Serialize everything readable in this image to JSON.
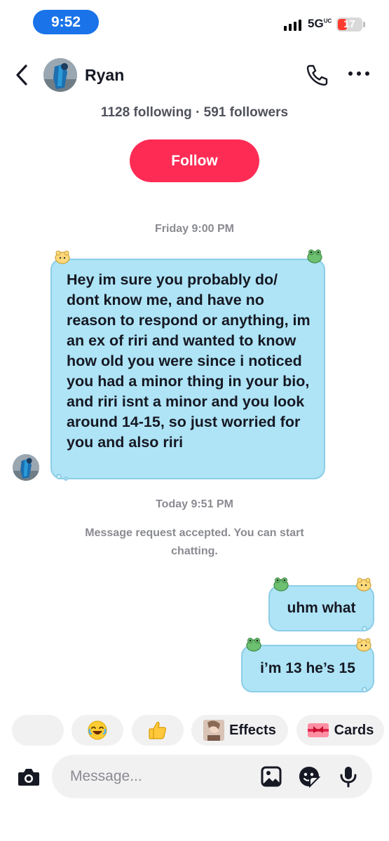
{
  "status_bar": {
    "time": "9:52",
    "network": "5G",
    "network_sup": "UC",
    "battery": "17"
  },
  "header": {
    "name": "Ryan"
  },
  "profile": {
    "stats": "1128 following · 591 followers",
    "follow_label": "Follow"
  },
  "messages": [
    {
      "timestamp": "Friday 9:00 PM",
      "from": "them",
      "text": "Hey im sure you probably do/ dont know me, and have no reason to respond or anything, im an ex of riri and wanted to know how old you were since i noticed you had a minor thing in your bio, and riri isnt a minor and you look around 14-15, so just worried for you and also riri"
    },
    {
      "timestamp": "Today 9:51 PM",
      "system": "Message request accepted. You can start chatting."
    },
    {
      "from": "me",
      "text": "uhm what"
    },
    {
      "from": "me",
      "text": "i’m 13 he’s 15"
    }
  ],
  "quick_actions": {
    "effects_label": "Effects",
    "cards_label": "Cards"
  },
  "composer": {
    "placeholder": "Message..."
  },
  "colors": {
    "accent": "#fe2c55",
    "bubble": "#aee4f6",
    "time_pill": "#1a73e8"
  }
}
